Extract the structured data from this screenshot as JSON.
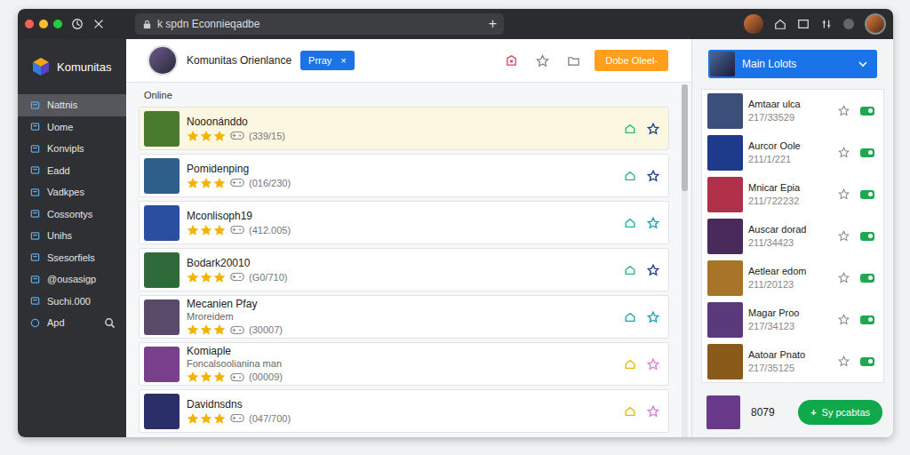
{
  "window": {
    "address": "k spdn Econnieqadbe",
    "new_tab": "+"
  },
  "sidebar": {
    "logo": "Komunitas",
    "items": [
      {
        "label": "Nattnis",
        "selected": true
      },
      {
        "label": "Uome",
        "selected": false
      },
      {
        "label": "Konvipls",
        "selected": false
      },
      {
        "label": "Eadd",
        "selected": false
      },
      {
        "label": "Vadkpes",
        "selected": false
      },
      {
        "label": "Cossontys",
        "selected": false
      },
      {
        "label": "Unihs",
        "selected": false
      },
      {
        "label": "Ssesorfiels",
        "selected": false
      },
      {
        "label": "@ousasigp",
        "selected": false
      },
      {
        "label": "Suchi.000",
        "selected": false
      },
      {
        "label": "Apd",
        "selected": false
      }
    ]
  },
  "header": {
    "title": "Komunitas Orienlance",
    "chip": {
      "label": "Prray",
      "close": "×"
    },
    "action": "Dobe Oleel-"
  },
  "section": "Online",
  "players": [
    {
      "name": "Nooonánddo",
      "subtitle": "",
      "count": "(339/15)",
      "stars": 3,
      "highlighted": true,
      "color": "#2bb673",
      "star_color": "#1f3f8a"
    },
    {
      "name": "Pomidenping",
      "subtitle": "",
      "count": "(016/230)",
      "stars": 3,
      "highlighted": false,
      "color": "#2bb673",
      "star_color": "#1f3f8a"
    },
    {
      "name": "Mconlisoph19",
      "subtitle": "",
      "count": "(412.005)",
      "stars": 3,
      "highlighted": false,
      "color": "#19b39a",
      "star_color": "#1aa3b8"
    },
    {
      "name": "Bodark20010",
      "subtitle": "",
      "count": "(G0/710)",
      "stars": 3,
      "highlighted": false,
      "color": "#2bb673",
      "star_color": "#1f3f8a"
    },
    {
      "name": "Mecanien Pfay",
      "subtitle": "Mroreidem",
      "count": "(30007)",
      "stars": 3,
      "highlighted": false,
      "color": "#1aa3b8",
      "star_color": "#1aa3b8"
    },
    {
      "name": "Komiaple",
      "subtitle": "Foncalsoolianina man",
      "count": "(00009)",
      "stars": 3,
      "highlighted": false,
      "color": "#e6b800",
      "star_color": "#e07ad8"
    },
    {
      "name": "Davidnsdns",
      "subtitle": "",
      "count": "(047/700)",
      "stars": 3,
      "highlighted": false,
      "color": "#e6b800",
      "star_color": "#e07ad8"
    }
  ],
  "panel": {
    "dropdown": "Main Lolots",
    "items": [
      {
        "name": "Amtaar ulca",
        "code": "217/33529",
        "on": true
      },
      {
        "name": "Aurcor Oole",
        "code": "211/1/221",
        "on": true
      },
      {
        "name": "Mnicar Epia",
        "code": "211/722232",
        "on": true
      },
      {
        "name": "Auscar dorad",
        "code": "211/34423",
        "on": true
      },
      {
        "name": "Aetlear edom",
        "code": "211/20123",
        "on": true
      },
      {
        "name": "Magar Proo",
        "code": "217/34123",
        "on": true
      },
      {
        "name": "Aatoar Pnato",
        "code": "217/35125",
        "on": true
      }
    ],
    "footer": {
      "count": "8079",
      "button_icon": "+",
      "button": "Sy pcabtas"
    }
  }
}
